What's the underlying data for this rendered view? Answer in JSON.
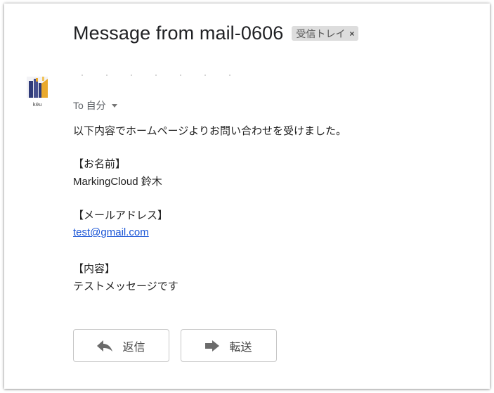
{
  "message": {
    "subject": "Message from mail-0606",
    "label": "受信トレイ",
    "label_remove": "×"
  },
  "sender": {
    "avatar_caption": "k0u",
    "avatar_icon": "avatar-icon"
  },
  "recipient": {
    "to_text": "To 自分"
  },
  "body": {
    "intro": "以下内容でホームページよりお問い合わせを受けました。",
    "name_heading": "【お名前】",
    "name_value": "MarkingCloud 鈴木",
    "email_heading": "【メールアドレス】",
    "email_value": "test@gmail.com",
    "content_heading": "【内容】",
    "content_value": "テストメッセージです"
  },
  "actions": {
    "reply_label": "返信",
    "forward_label": "転送"
  },
  "colors": {
    "link": "#1a55d6",
    "chip_bg": "#dddddd",
    "avatar_navy": "#2f3b79",
    "avatar_gold": "#e9a92d"
  }
}
